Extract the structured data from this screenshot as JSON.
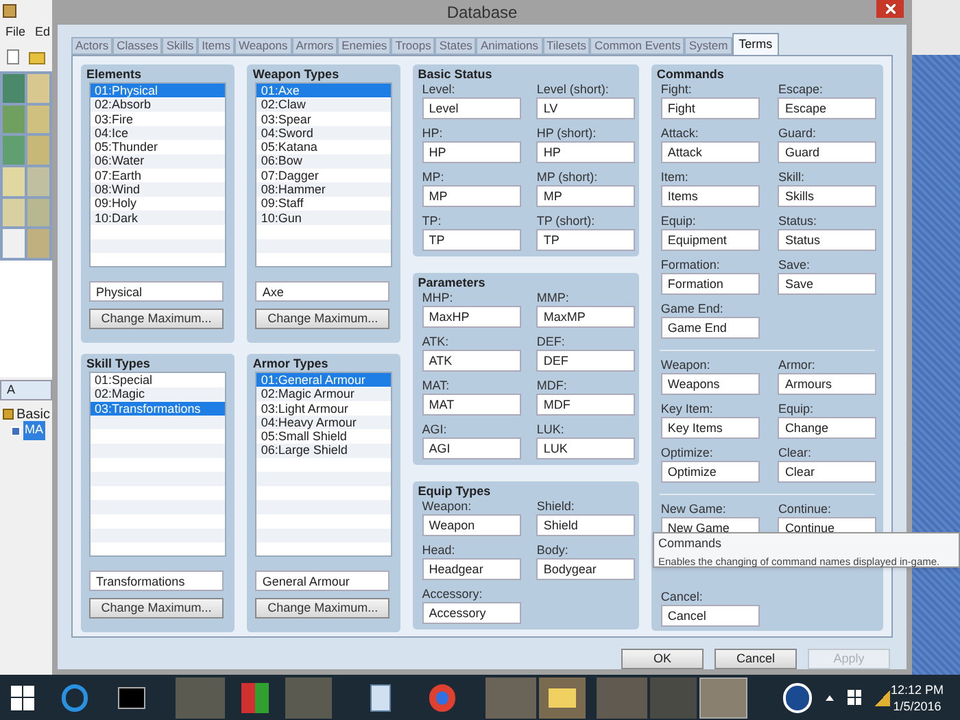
{
  "background_app": {
    "menu": [
      "File",
      "Ed"
    ],
    "tab": "A",
    "tree": [
      {
        "label": "Basic",
        "children": [
          {
            "label": "MA",
            "selected": true
          }
        ]
      }
    ]
  },
  "dialog": {
    "title": "Database",
    "tabs": [
      {
        "label": "Actors",
        "selected": false
      },
      {
        "label": "Classes",
        "selected": false
      },
      {
        "label": "Skills",
        "selected": false
      },
      {
        "label": "Items",
        "selected": false
      },
      {
        "label": "Weapons",
        "selected": false
      },
      {
        "label": "Armors",
        "selected": false
      },
      {
        "label": "Enemies",
        "selected": false
      },
      {
        "label": "Troops",
        "selected": false
      },
      {
        "label": "States",
        "selected": false
      },
      {
        "label": "Animations",
        "selected": false
      },
      {
        "label": "Tilesets",
        "selected": false
      },
      {
        "label": "Common Events",
        "selected": false
      },
      {
        "label": "System",
        "selected": false
      },
      {
        "label": "Terms",
        "selected": true
      }
    ],
    "list_groups": [
      {
        "title": "Elements",
        "items": [
          {
            "label": "01:Physical",
            "selected": true
          },
          {
            "label": "02:Absorb",
            "selected": false
          },
          {
            "label": "03:Fire",
            "selected": false
          },
          {
            "label": "04:Ice",
            "selected": false
          },
          {
            "label": "05:Thunder",
            "selected": false
          },
          {
            "label": "06:Water",
            "selected": false
          },
          {
            "label": "07:Earth",
            "selected": false
          },
          {
            "label": "08:Wind",
            "selected": false
          },
          {
            "label": "09:Holy",
            "selected": false
          },
          {
            "label": "10:Dark",
            "selected": false
          }
        ],
        "name_value": "Physical",
        "button": "Change Maximum..."
      },
      {
        "title": "Weapon Types",
        "items": [
          {
            "label": "01:Axe",
            "selected": true
          },
          {
            "label": "02:Claw",
            "selected": false
          },
          {
            "label": "03:Spear",
            "selected": false
          },
          {
            "label": "04:Sword",
            "selected": false
          },
          {
            "label": "05:Katana",
            "selected": false
          },
          {
            "label": "06:Bow",
            "selected": false
          },
          {
            "label": "07:Dagger",
            "selected": false
          },
          {
            "label": "08:Hammer",
            "selected": false
          },
          {
            "label": "09:Staff",
            "selected": false
          },
          {
            "label": "10:Gun",
            "selected": false
          }
        ],
        "name_value": "Axe",
        "button": "Change Maximum..."
      },
      {
        "title": "Skill Types",
        "items": [
          {
            "label": "01:Special",
            "selected": false
          },
          {
            "label": "02:Magic",
            "selected": false
          },
          {
            "label": "03:Transformations",
            "selected": true
          }
        ],
        "name_value": "Transformations",
        "button": "Change Maximum..."
      },
      {
        "title": "Armor Types",
        "items": [
          {
            "label": "01:General Armour",
            "selected": true
          },
          {
            "label": "02:Magic Armour",
            "selected": false
          },
          {
            "label": "03:Light Armour",
            "selected": false
          },
          {
            "label": "04:Heavy Armour",
            "selected": false
          },
          {
            "label": "05:Small Shield",
            "selected": false
          },
          {
            "label": "06:Large Shield",
            "selected": false
          }
        ],
        "name_value": "General Armour",
        "button": "Change Maximum..."
      }
    ],
    "field_groups": [
      {
        "title": "Basic Status",
        "fields": [
          {
            "label": "Level:",
            "value": "Level"
          },
          {
            "label": "Level (short):",
            "value": "LV"
          },
          {
            "label": "HP:",
            "value": "HP"
          },
          {
            "label": "HP (short):",
            "value": "HP"
          },
          {
            "label": "MP:",
            "value": "MP"
          },
          {
            "label": "MP (short):",
            "value": "MP"
          },
          {
            "label": "TP:",
            "value": "TP"
          },
          {
            "label": "TP (short):",
            "value": "TP"
          }
        ]
      },
      {
        "title": "Parameters",
        "fields": [
          {
            "label": "MHP:",
            "value": "MaxHP"
          },
          {
            "label": "MMP:",
            "value": "MaxMP"
          },
          {
            "label": "ATK:",
            "value": "ATK"
          },
          {
            "label": "DEF:",
            "value": "DEF"
          },
          {
            "label": "MAT:",
            "value": "MAT"
          },
          {
            "label": "MDF:",
            "value": "MDF"
          },
          {
            "label": "AGI:",
            "value": "AGI"
          },
          {
            "label": "LUK:",
            "value": "LUK"
          }
        ]
      },
      {
        "title": "Equip Types",
        "fields": [
          {
            "label": "Weapon:",
            "value": "Weapon"
          },
          {
            "label": "Shield:",
            "value": "Shield"
          },
          {
            "label": "Head:",
            "value": "Headgear"
          },
          {
            "label": "Body:",
            "value": "Bodygear"
          },
          {
            "label": "Accessory:",
            "value": "Accessory"
          }
        ]
      }
    ],
    "commands": {
      "title": "Commands",
      "sections": [
        [
          {
            "label": "Fight:",
            "value": "Fight"
          },
          {
            "label": "Escape:",
            "value": "Escape"
          },
          {
            "label": "Attack:",
            "value": "Attack"
          },
          {
            "label": "Guard:",
            "value": "Guard"
          },
          {
            "label": "Item:",
            "value": "Items"
          },
          {
            "label": "Skill:",
            "value": "Skills"
          },
          {
            "label": "Equip:",
            "value": "Equipment"
          },
          {
            "label": "Status:",
            "value": "Status"
          },
          {
            "label": "Formation:",
            "value": "Formation"
          },
          {
            "label": "Save:",
            "value": "Save"
          },
          {
            "label": "Game End:",
            "value": "Game End"
          }
        ],
        [
          {
            "label": "Weapon:",
            "value": "Weapons"
          },
          {
            "label": "Armor:",
            "value": "Armours"
          },
          {
            "label": "Key Item:",
            "value": "Key Items"
          },
          {
            "label": "Equip:",
            "value": "Change"
          },
          {
            "label": "Optimize:",
            "value": "Optimize"
          },
          {
            "label": "Clear:",
            "value": "Clear"
          }
        ],
        [
          {
            "label": "New Game:",
            "value": "New Game"
          },
          {
            "label": "Continue:",
            "value": "Continue"
          },
          {
            "kind": "hidden"
          },
          {
            "kind": "hidden"
          },
          {
            "label": "Cancel:",
            "value": "Cancel"
          }
        ]
      ]
    },
    "tooltip": {
      "title": "Commands",
      "text": "Enables the changing of command names displayed in-game."
    },
    "buttons": [
      {
        "label": "OK",
        "disabled": false
      },
      {
        "label": "Cancel",
        "disabled": false
      },
      {
        "label": "Apply",
        "disabled": true
      }
    ]
  },
  "taskbar": {
    "time": "12:12 PM",
    "date": "1/5/2016"
  }
}
